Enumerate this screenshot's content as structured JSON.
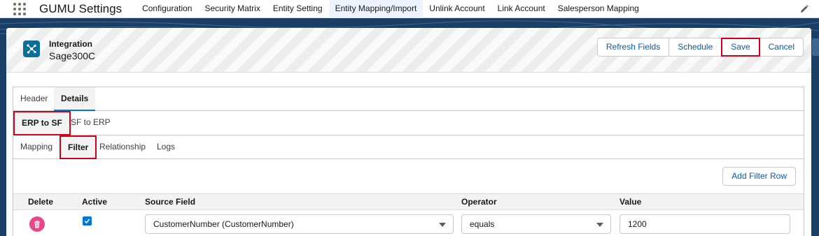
{
  "app": {
    "name": "GUMU Settings"
  },
  "nav": {
    "items": [
      {
        "label": "Configuration",
        "active": false
      },
      {
        "label": "Security Matrix",
        "active": false
      },
      {
        "label": "Entity Setting",
        "active": false
      },
      {
        "label": "Entity Mapping/Import",
        "active": true
      },
      {
        "label": "Unlink Account",
        "active": false
      },
      {
        "label": "Link Account",
        "active": false
      },
      {
        "label": "Salesperson Mapping",
        "active": false
      }
    ]
  },
  "record": {
    "label": "Integration",
    "title": "Sage300C",
    "icon": "integration-icon"
  },
  "actions": {
    "refresh_fields": "Refresh Fields",
    "schedule": "Schedule",
    "save": "Save",
    "cancel": "Cancel"
  },
  "tabs": {
    "level1": [
      {
        "label": "Header",
        "active": false
      },
      {
        "label": "Details",
        "active": true
      }
    ],
    "level2": [
      {
        "label": "ERP to SF",
        "active": true
      },
      {
        "label": "SF to ERP",
        "active": false
      }
    ],
    "level3": [
      {
        "label": "Mapping",
        "active": false
      },
      {
        "label": "Filter",
        "active": true
      },
      {
        "label": "Relationship",
        "active": false
      },
      {
        "label": "Logs",
        "active": false
      }
    ]
  },
  "filter": {
    "add_row_label": "Add Filter Row",
    "columns": {
      "delete": "Delete",
      "active": "Active",
      "source_field": "Source Field",
      "operator": "Operator",
      "value": "Value"
    },
    "rows": [
      {
        "active": true,
        "source_field": "CustomerNumber (CustomerNumber)",
        "operator": "equals",
        "value": "1200"
      }
    ]
  },
  "colors": {
    "accent": "#0176d3",
    "highlight": "#d0021b",
    "delete": "#e8488a",
    "band": "#1a3f66"
  }
}
